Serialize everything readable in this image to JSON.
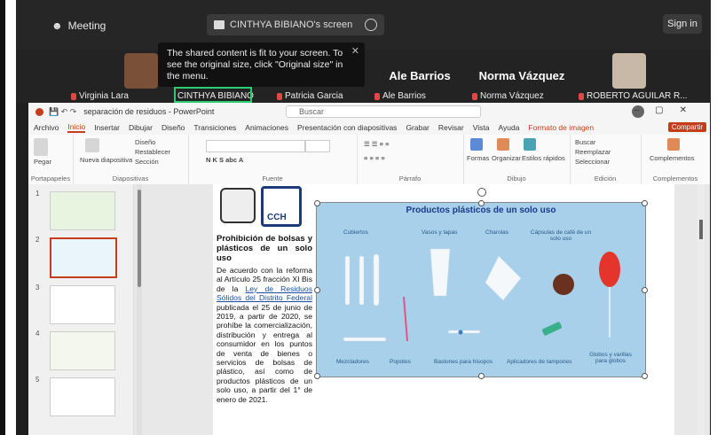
{
  "meeting": {
    "label": "Meeting",
    "screen_tab": "CINTHYA BIBIANO's screen",
    "signin": "Sign in"
  },
  "tooltip": "The shared content is fit to your screen. To see the original size, click \"Original size\" in the menu.",
  "participants": [
    {
      "name": "Virginia Lara"
    },
    {
      "name": "CINTHYA BIBIANO"
    },
    {
      "name": "Patricia Garcia"
    },
    {
      "name": "Ale Barrios",
      "display": "Ale Barrios"
    },
    {
      "name": "Norma Vázquez",
      "display": "Norma Vázquez"
    },
    {
      "name": "ROBERTO AGUILAR R..."
    }
  ],
  "ppt": {
    "file_title": "separación de residuos - PowerPoint",
    "search": "Buscar",
    "tabs": [
      "Archivo",
      "Inicio",
      "Insertar",
      "Dibujar",
      "Diseño",
      "Transiciones",
      "Animaciones",
      "Presentación con diapositivas",
      "Grabar",
      "Revisar",
      "Vista",
      "Ayuda",
      "Formato de imagen"
    ],
    "share": "Compartir",
    "groups": [
      "Portapapeles",
      "Diapositivas",
      "Fuente",
      "Párrafo",
      "Dibujo",
      "Edición",
      "Complementos"
    ],
    "ribbon_items": {
      "paste": "Pegar",
      "new_slide": "Nueva diapositiva",
      "layout": "Diseño",
      "reset": "Restablecer",
      "section": "Sección",
      "shapes": "Formas",
      "arrange": "Organizar",
      "quick_styles": "Estilos rápidos",
      "find": "Buscar",
      "replace": "Reemplazar",
      "select": "Seleccionar",
      "addins": "Complementos"
    },
    "slide_numbers": [
      "1",
      "2",
      "3",
      "4",
      "5"
    ]
  },
  "slide": {
    "heading": "Prohibición de bolsas y plásticos de un solo uso",
    "p1": "De acuerdo con la reforma al Artículo 25 fracción XI Bis de la",
    "link": "Ley de Residuos Sólidos del Distrito Federal",
    "p2": "publicada el 25 de junio de 2019, a partir de 2020, se prohíbe la comercialización, distribución y entrega al consumidor en los puntos de venta de bienes o servicios de bolsas de plástico, así como de productos plásticos de un solo uso, a partir del 1° de enero de 2021.",
    "logo_text": "CCH",
    "panel_title": "Productos plásticos de un solo uso",
    "labels": [
      "Cubiertos",
      "Vasos y tapas",
      "Charolas",
      "Cápsulas de café de un solo uso",
      "Mezcladores",
      "Popotes",
      "Bastones para hisopos",
      "Aplicadores de tampones",
      "Globos y varillas para globos"
    ]
  },
  "colors": {
    "ppt_accent": "#c43e1c",
    "panel_bg": "#a9d0ea",
    "panel_title": "#1a3a8a"
  }
}
